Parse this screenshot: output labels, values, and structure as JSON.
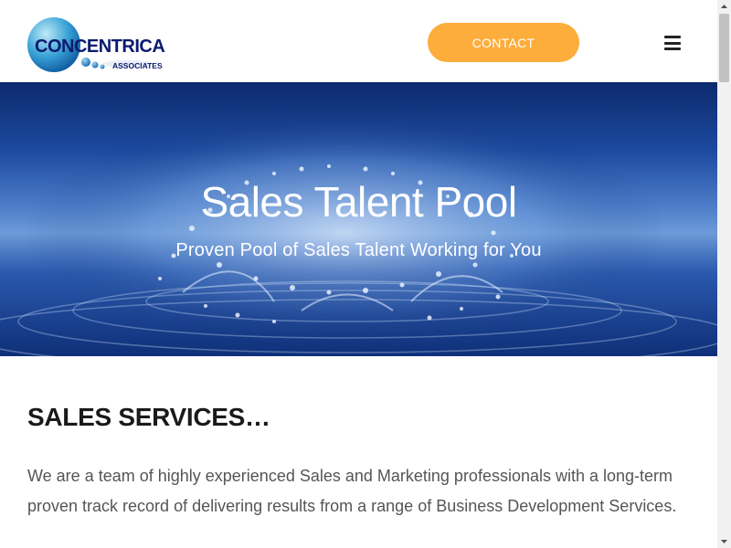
{
  "header": {
    "logo": {
      "name": "CONCENTRICA",
      "sub": "ASSOCIATES"
    },
    "contact_label": "CONTACT",
    "menu_icon": "hamburger-menu-icon"
  },
  "hero": {
    "title": "Sales Talent Pool",
    "subtitle": "Proven Pool of Sales Talent Working for You",
    "background": "water-splash-image"
  },
  "section": {
    "heading": "SALES SERVICES…",
    "text": "We are a team of highly experienced Sales and Marketing professionals with a long-term proven track record of delivering results from a range of Business Development Services."
  },
  "colors": {
    "accent": "#fdad3b",
    "logo_text": "#0b1b6e",
    "heading": "#1a1a1a",
    "body_text": "#555555"
  }
}
